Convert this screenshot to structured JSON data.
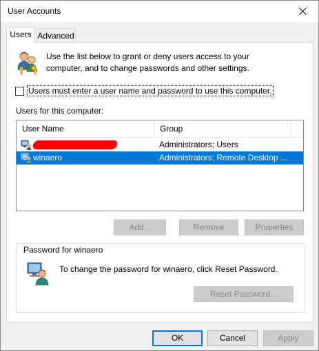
{
  "window": {
    "title": "User Accounts"
  },
  "tabs": [
    {
      "label": "Users",
      "active": true
    },
    {
      "label": "Advanced",
      "active": false
    }
  ],
  "intro": {
    "text": "Use the list below to grant or deny users access to your computer, and to change passwords and other settings."
  },
  "checkbox": {
    "label": "Users must enter a user name and password to use this computer.",
    "checked": false
  },
  "users_list": {
    "label": "Users for this computer:",
    "columns": [
      "User Name",
      "Group"
    ],
    "rows": [
      {
        "name": "",
        "group": "Administrators; Users",
        "redacted": true,
        "selected": false
      },
      {
        "name": "winaero",
        "group": "Administrators; Remote Desktop ...",
        "redacted": false,
        "selected": true
      }
    ]
  },
  "list_buttons": {
    "add": "Add...",
    "remove": "Remove",
    "properties": "Properties"
  },
  "password_group": {
    "title": "Password for winaero",
    "text": "To change the password for winaero, click Reset Password.",
    "reset_button": "Reset Password..."
  },
  "dialog_buttons": {
    "ok": "OK",
    "cancel": "Cancel",
    "apply": "Apply"
  },
  "icons": {
    "users": "users-keys-icon",
    "user_row": "user-computer-icon",
    "password": "user-password-icon",
    "close": "close-icon"
  },
  "colors": {
    "selection": "#0078d7",
    "redaction": "#ff0000"
  }
}
